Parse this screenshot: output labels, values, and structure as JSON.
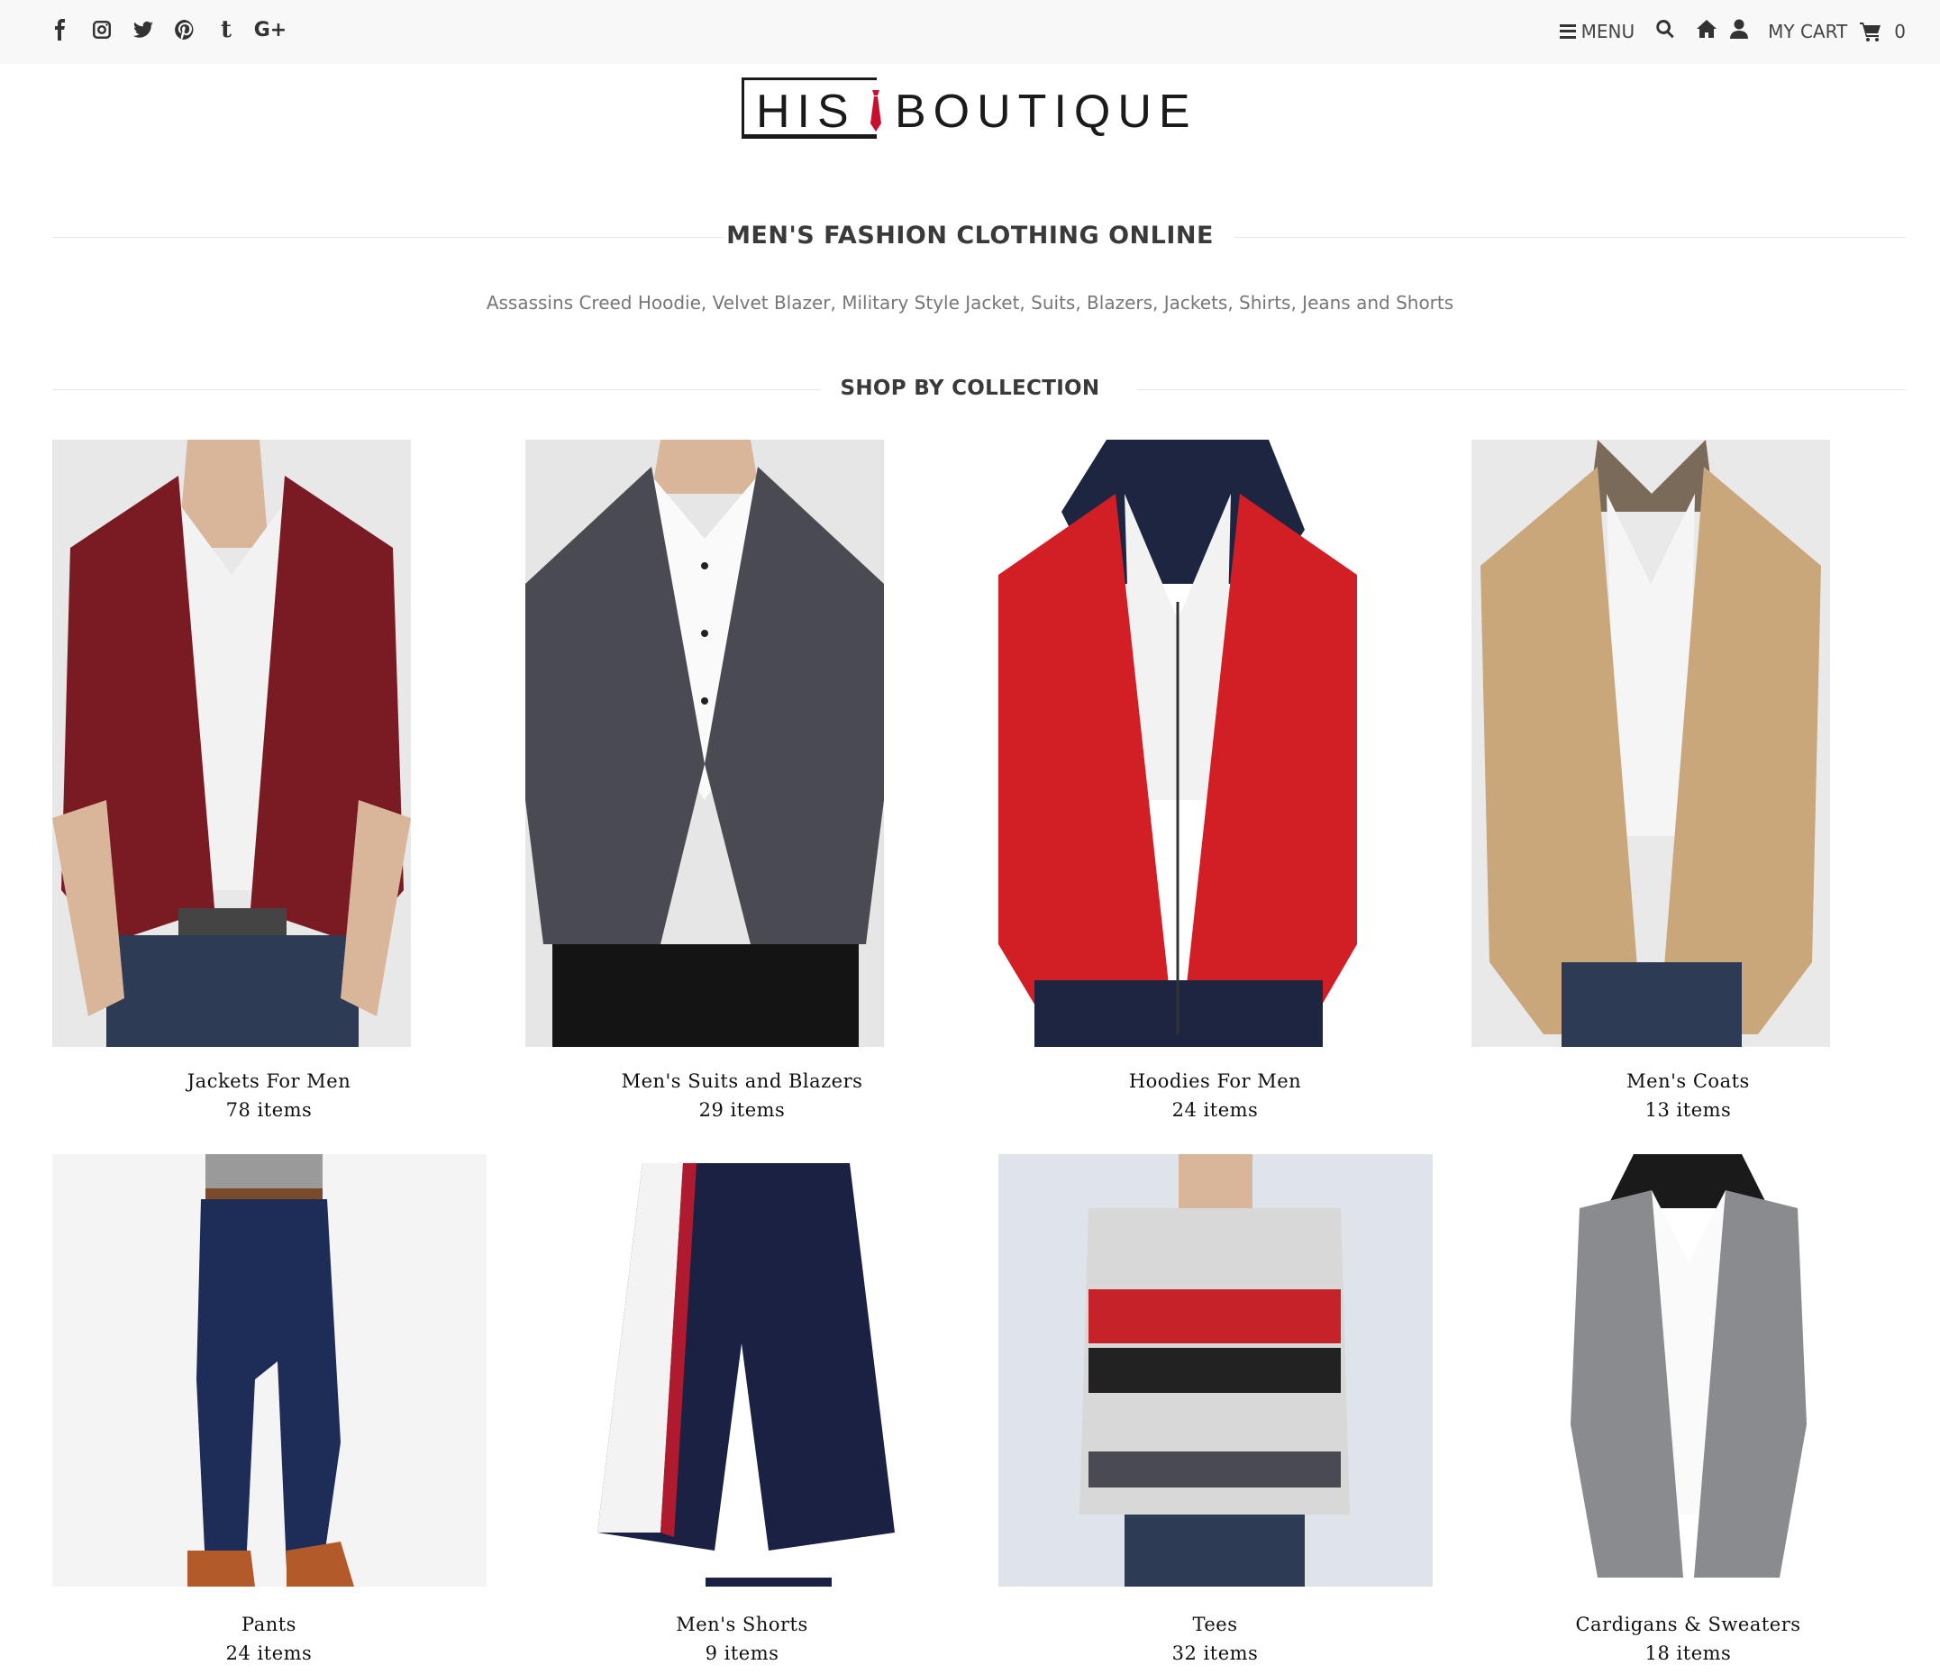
{
  "topbar": {
    "social": [
      "facebook-icon",
      "instagram-icon",
      "twitter-icon",
      "pinterest-icon",
      "tumblr-icon",
      "google-plus-icon"
    ],
    "menu_label": "MENU",
    "cart_label": "MY CART",
    "cart_count": "0"
  },
  "logo": {
    "left": "HIS",
    "right": "BOUTIQUE",
    "accent": "#c8102e"
  },
  "headline": "MEN'S FASHION CLOTHING ONLINE",
  "subtitle": "Assassins Creed Hoodie, Velvet Blazer, Military Style Jacket, Suits, Blazers, Jackets, Shirts, Jeans and Shorts",
  "shop_heading": "SHOP BY COLLECTION",
  "collections": [
    {
      "title": "Jackets For Men",
      "count": "78 items",
      "garment": "#7a1a22",
      "bg": "#e8e8e8"
    },
    {
      "title": "Men's Suits and Blazers",
      "count": "29 items",
      "garment": "#4a4b52",
      "bg": "#e6e6e6"
    },
    {
      "title": "Hoodies For Men",
      "count": "24 items",
      "garment": "#d21e25",
      "bg": "#ffffff"
    },
    {
      "title": "Men's Coats",
      "count": "13 items",
      "garment": "#c9a77a",
      "bg": "#e9e9e9"
    },
    {
      "title": "Pants",
      "count": "24 items",
      "garment": "#1e2d57",
      "bg": "#f4f4f4"
    },
    {
      "title": "Men's Shorts",
      "count": "9 items",
      "garment": "#1b2142",
      "bg": "#ffffff"
    },
    {
      "title": "Tees",
      "count": "32 items",
      "garment": "#c5222a",
      "bg": "#dfe3ea"
    },
    {
      "title": "Cardigans & Sweaters",
      "count": "18 items",
      "garment": "#8a8b8f",
      "bg": "#ffffff"
    }
  ]
}
